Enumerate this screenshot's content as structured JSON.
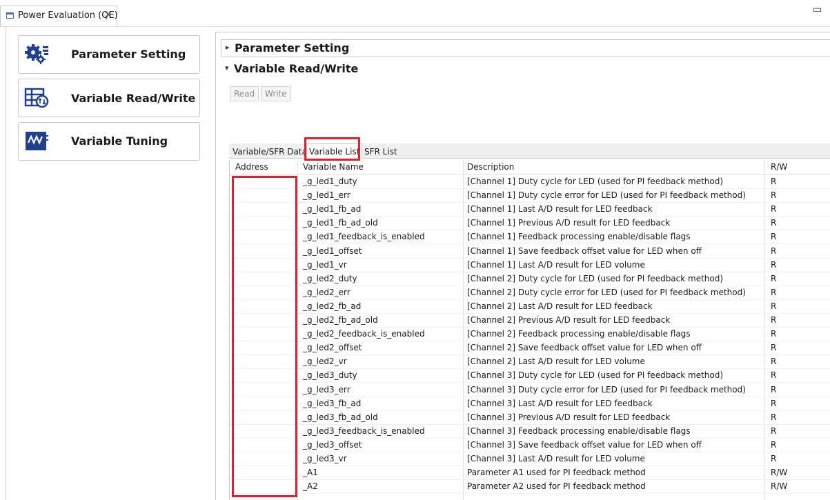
{
  "view_tab": {
    "title": "Power Evaluation (QE)"
  },
  "nav": {
    "items": [
      {
        "label": "Parameter Setting",
        "icon": "gears-icon"
      },
      {
        "label": "Variable Read/Write",
        "icon": "table-sync-icon"
      },
      {
        "label": "Variable Tuning",
        "icon": "waveform-icon"
      }
    ]
  },
  "sections": {
    "parameter_setting": "Parameter Setting",
    "variable_rw": "Variable Read/Write"
  },
  "buttons": {
    "read": "Read",
    "write": "Write"
  },
  "tabs": [
    "Variable/SFR Data",
    "Variable List",
    "SFR List"
  ],
  "active_tab": "Variable List",
  "table": {
    "columns": [
      "Address",
      "Variable Name",
      "Description",
      "R/W"
    ],
    "rows": [
      [
        "",
        "_g_led1_duty",
        "[Channel 1] Duty cycle for LED (used for PI feedback method)",
        "R"
      ],
      [
        "",
        "_g_led1_err",
        "[Channel 1] Duty cycle error for LED (used for PI feedback method)",
        "R"
      ],
      [
        "",
        "_g_led1_fb_ad",
        "[Channel 1] Last A/D result for LED feedback",
        "R"
      ],
      [
        "",
        "_g_led1_fb_ad_old",
        "[Channel 1] Previous A/D result for LED feedback",
        "R"
      ],
      [
        "",
        "_g_led1_feedback_is_enabled",
        "[Channel 1] Feedback processing enable/disable flags",
        "R"
      ],
      [
        "",
        "_g_led1_offset",
        "[Channel 1] Save feedback offset value for LED when off",
        "R"
      ],
      [
        "",
        "_g_led1_vr",
        "[Channel 1] Last A/D result for LED volume",
        "R"
      ],
      [
        "",
        "_g_led2_duty",
        "[Channel 2] Duty cycle for LED (used for PI feedback method)",
        "R"
      ],
      [
        "",
        "_g_led2_err",
        "[Channel 2] Duty cycle error for LED (used for PI feedback method)",
        "R"
      ],
      [
        "",
        "_g_led2_fb_ad",
        "[Channel 2] Last A/D result for LED feedback",
        "R"
      ],
      [
        "",
        "_g_led2_fb_ad_old",
        "[Channel 2] Previous A/D result for LED feedback",
        "R"
      ],
      [
        "",
        "_g_led2_feedback_is_enabled",
        "[Channel 2] Feedback processing enable/disable flags",
        "R"
      ],
      [
        "",
        "_g_led2_offset",
        "[Channel 2] Save feedback offset value for LED when off",
        "R"
      ],
      [
        "",
        "_g_led2_vr",
        "[Channel 2] Last A/D result for LED volume",
        "R"
      ],
      [
        "",
        "_g_led3_duty",
        "[Channel 3] Duty cycle for LED (used for PI feedback method)",
        "R"
      ],
      [
        "",
        "_g_led3_err",
        "[Channel 3] Duty cycle error for LED (used for PI feedback method)",
        "R"
      ],
      [
        "",
        "_g_led3_fb_ad",
        "[Channel 3] Last A/D result for LED feedback",
        "R"
      ],
      [
        "",
        "_g_led3_fb_ad_old",
        "[Channel 3] Previous A/D result for LED feedback",
        "R"
      ],
      [
        "",
        "_g_led3_feedback_is_enabled",
        "[Channel 3] Feedback processing enable/disable flags",
        "R"
      ],
      [
        "",
        "_g_led3_offset",
        "[Channel 3] Save feedback offset value for LED when off",
        "R"
      ],
      [
        "",
        "_g_led3_vr",
        "[Channel 3] Last A/D result for LED volume",
        "R"
      ],
      [
        "",
        "_A1",
        "Parameter A1 used for PI feedback method",
        "R/W"
      ],
      [
        "",
        "_A2",
        "Parameter A2 used for PI feedback method",
        "R/W"
      ]
    ]
  },
  "colors": {
    "highlight": "#e0202b",
    "icon_blue": "#1f3f8f"
  }
}
